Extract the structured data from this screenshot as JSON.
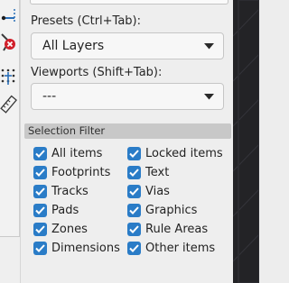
{
  "toolbar": {
    "tools": [
      {
        "icon": "route-track-icon"
      },
      {
        "icon": "delete-icon"
      },
      {
        "icon": "grid-icon"
      },
      {
        "icon": "measure-icon"
      }
    ]
  },
  "presets": {
    "label": "Presets (Ctrl+Tab):",
    "value": "All Layers"
  },
  "viewports": {
    "label": "Viewports (Shift+Tab):",
    "value": "---"
  },
  "selection_filter": {
    "title": "Selection Filter",
    "items": [
      {
        "label": "All items",
        "checked": true
      },
      {
        "label": "Locked items",
        "checked": true
      },
      {
        "label": "Footprints",
        "checked": true
      },
      {
        "label": "Text",
        "checked": true
      },
      {
        "label": "Tracks",
        "checked": true
      },
      {
        "label": "Vias",
        "checked": true
      },
      {
        "label": "Pads",
        "checked": true
      },
      {
        "label": "Graphics",
        "checked": true
      },
      {
        "label": "Zones",
        "checked": true
      },
      {
        "label": "Rule Areas",
        "checked": true
      },
      {
        "label": "Dimensions",
        "checked": true
      },
      {
        "label": "Other items",
        "checked": true
      }
    ]
  },
  "colors": {
    "checkbox": "#2a7cc7",
    "accent_red": "#d11f2a",
    "canvas_dark": "#232326"
  }
}
